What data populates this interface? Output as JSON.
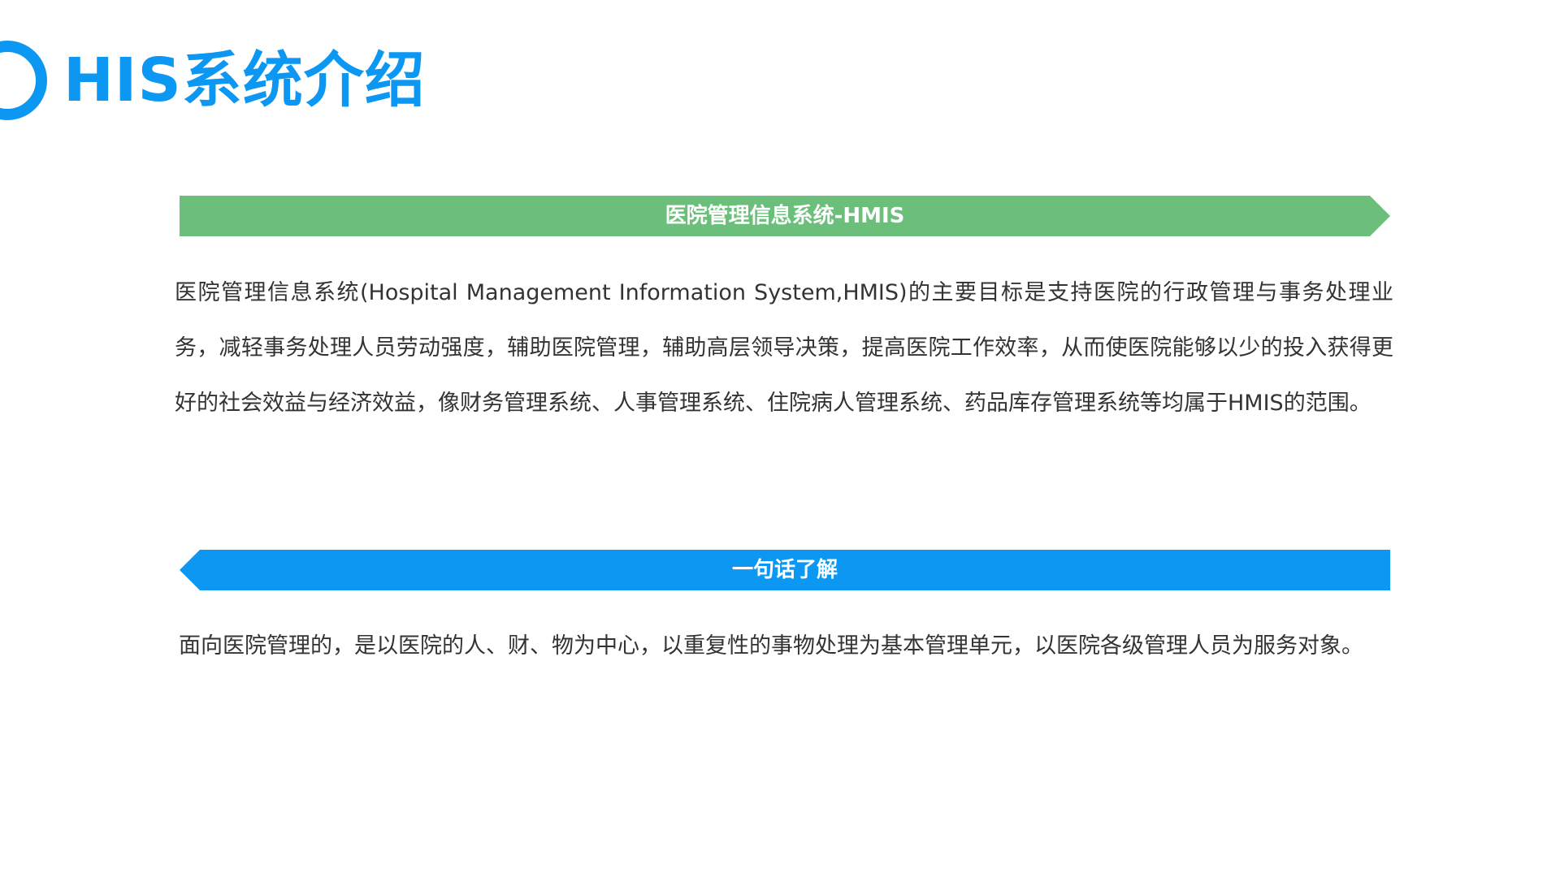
{
  "page": {
    "title": "HIS系统介绍"
  },
  "sections": [
    {
      "heading": "医院管理信息系统-HMIS",
      "text": "医院管理信息系统(Hospital Management Information System,HMIS)的主要目标是支持医院的行政管理与事务处理业务，减轻事务处理人员劳动强度，辅助医院管理，辅助高层领导决策，提高医院工作效率，从而使医院能够以少的投入获得更好的社会效益与经济效益，像财务管理系统、人事管理系统、住院病人管理系统、药品库存管理系统等均属于HMIS的范围。"
    },
    {
      "heading": "一句话了解",
      "text": "面向医院管理的，是以医院的人、财、物为中心，以重复性的事物处理为基本管理单元，以医院各级管理人员为服务对象。"
    }
  ],
  "colors": {
    "accent_blue": "#0b97f2",
    "accent_green": "#6cbf7b",
    "body_text": "#333333"
  }
}
